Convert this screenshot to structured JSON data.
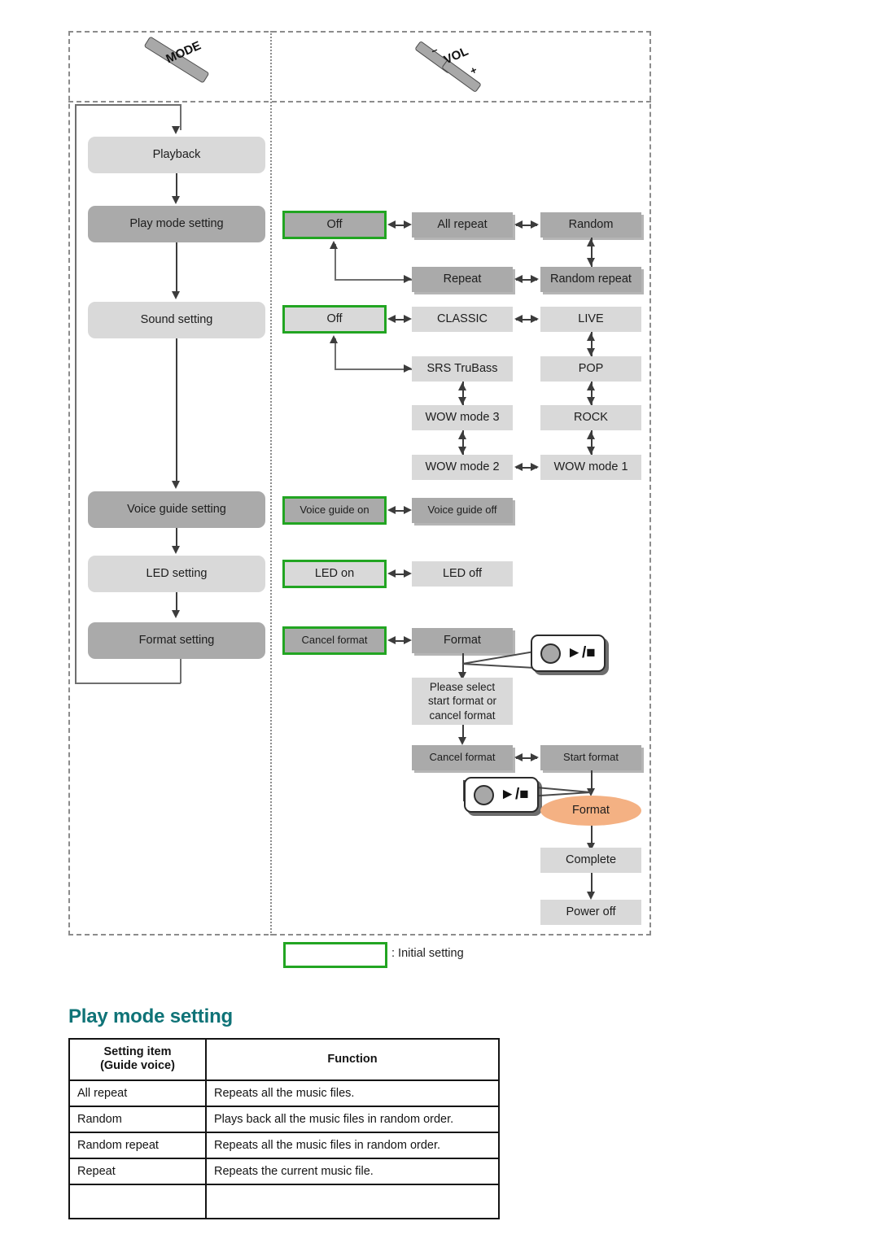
{
  "diagram": {
    "buttons": [
      {
        "name": "mode-button",
        "label": "MODE"
      },
      {
        "name": "vol-button",
        "label": "VOL",
        "minus": "–",
        "plus": "+"
      }
    ],
    "menu_column": [
      {
        "label": "Playback",
        "tone": "light"
      },
      {
        "label": "Play mode setting",
        "tone": "mid"
      },
      {
        "label": "Sound setting",
        "tone": "light"
      },
      {
        "label": "Voice guide setting",
        "tone": "mid"
      },
      {
        "label": "LED setting",
        "tone": "light"
      },
      {
        "label": "Format setting",
        "tone": "mid"
      }
    ],
    "play_mode_options": [
      {
        "label": "Off",
        "initial": true
      },
      {
        "label": "All repeat",
        "initial": false
      },
      {
        "label": "Random",
        "initial": false
      },
      {
        "label": "Repeat",
        "initial": false
      },
      {
        "label": "Random repeat",
        "initial": false
      }
    ],
    "sound_options": [
      {
        "label": "Off",
        "initial": true
      },
      {
        "label": "CLASSIC",
        "initial": false
      },
      {
        "label": "LIVE",
        "initial": false
      },
      {
        "label": "SRS TruBass",
        "initial": false
      },
      {
        "label": "POP",
        "initial": false
      },
      {
        "label": "WOW mode 3",
        "initial": false
      },
      {
        "label": "ROCK",
        "initial": false
      },
      {
        "label": "WOW mode 2",
        "initial": false
      },
      {
        "label": "WOW mode 1",
        "initial": false
      }
    ],
    "voice_guide_options": [
      {
        "label": "Voice guide on",
        "initial": true
      },
      {
        "label": "Voice guide off",
        "initial": false
      }
    ],
    "led_options": [
      {
        "label": "LED on",
        "initial": true
      },
      {
        "label": "LED off",
        "initial": false
      }
    ],
    "format_flow": {
      "cancel_format_1": "Cancel format",
      "format": "Format",
      "prompt": "Please select\nstart format or\ncancel format",
      "cancel_format_2": "Cancel format",
      "start_format": "Start format",
      "formatting": "Format",
      "complete": "Complete",
      "power_off": "Power off",
      "callout_glyph": "►/■"
    },
    "legend": {
      "text": ": Initial setting",
      "color": "#22a522"
    }
  },
  "section": {
    "heading": "Play mode setting",
    "heading_color": "#0f7377",
    "table": {
      "headers": [
        "Setting item\n(Guide voice)",
        "Function"
      ],
      "header_line1": "Setting item",
      "header_line2": "(Guide voice)",
      "header_col2": "Function",
      "rows": [
        {
          "item": "All repeat",
          "function": "Repeats all the music files."
        },
        {
          "item": "Random",
          "function": "Plays back all the music files in random order."
        },
        {
          "item": "Random repeat",
          "function": "Repeats all the music files in random order."
        },
        {
          "item": "Repeat",
          "function": "Repeats the current music file."
        }
      ]
    }
  }
}
